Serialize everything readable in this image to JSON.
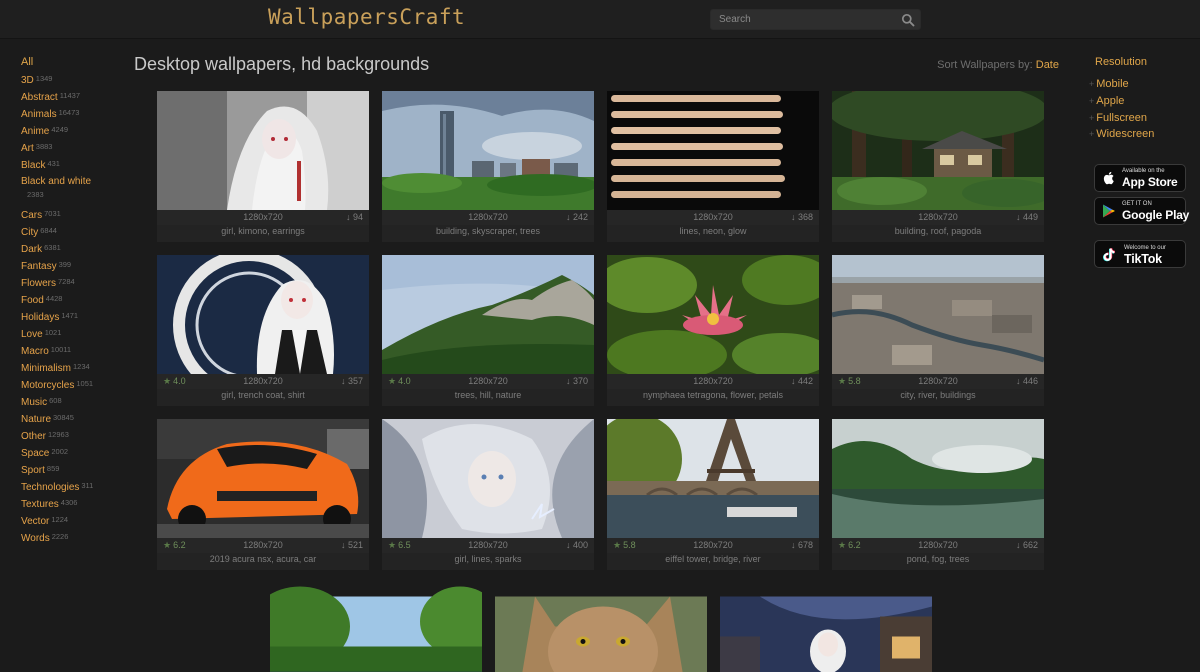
{
  "header": {
    "logo": "WallpapersCraft",
    "search_placeholder": "Search"
  },
  "categories": {
    "all_label": "All",
    "items": [
      {
        "name": "3D",
        "count": "1349"
      },
      {
        "name": "Abstract",
        "count": "11437"
      },
      {
        "name": "Animals",
        "count": "16473"
      },
      {
        "name": "Anime",
        "count": "4249"
      },
      {
        "name": "Art",
        "count": "3883"
      },
      {
        "name": "Black",
        "count": "431"
      },
      {
        "name": "Black and white",
        "count": "2383"
      },
      {
        "name": "Cars",
        "count": "7031"
      },
      {
        "name": "City",
        "count": "6844"
      },
      {
        "name": "Dark",
        "count": "6381"
      },
      {
        "name": "Fantasy",
        "count": "399"
      },
      {
        "name": "Flowers",
        "count": "7284"
      },
      {
        "name": "Food",
        "count": "4428"
      },
      {
        "name": "Holidays",
        "count": "1471"
      },
      {
        "name": "Love",
        "count": "1021"
      },
      {
        "name": "Macro",
        "count": "10011"
      },
      {
        "name": "Minimalism",
        "count": "1234"
      },
      {
        "name": "Motorcycles",
        "count": "1051"
      },
      {
        "name": "Music",
        "count": "608"
      },
      {
        "name": "Nature",
        "count": "30845"
      },
      {
        "name": "Other",
        "count": "12963"
      },
      {
        "name": "Space",
        "count": "2002"
      },
      {
        "name": "Sport",
        "count": "859"
      },
      {
        "name": "Technologies",
        "count": "311"
      },
      {
        "name": "Textures",
        "count": "4306"
      },
      {
        "name": "Vector",
        "count": "1224"
      },
      {
        "name": "Words",
        "count": "2226"
      }
    ]
  },
  "main": {
    "title": "Desktop wallpapers, hd backgrounds",
    "sort_label": "Sort Wallpapers by:",
    "sort_value": "Date"
  },
  "resolution": {
    "title": "Resolution",
    "items": [
      "Mobile",
      "Apple",
      "Fullscreen",
      "Widescreen"
    ]
  },
  "stores": {
    "appstore": {
      "small": "Available on the",
      "big": "App Store"
    },
    "googleplay": {
      "small": "GET IT ON",
      "big": "Google Play"
    },
    "tiktok": {
      "small": "Welcome to our",
      "big": "TikTok"
    }
  },
  "wallpapers": [
    {
      "rating": "",
      "resolution": "1280x720",
      "downloads": "↓ 94",
      "tags": "girl, kimono, earrings"
    },
    {
      "rating": "",
      "resolution": "1280x720",
      "downloads": "↓ 242",
      "tags": "building, skyscraper, trees"
    },
    {
      "rating": "",
      "resolution": "1280x720",
      "downloads": "↓ 368",
      "tags": "lines, neon, glow"
    },
    {
      "rating": "",
      "resolution": "1280x720",
      "downloads": "↓ 449",
      "tags": "building, roof, pagoda"
    },
    {
      "rating": "4.0",
      "resolution": "1280x720",
      "downloads": "↓ 357",
      "tags": "girl, trench coat, shirt"
    },
    {
      "rating": "4.0",
      "resolution": "1280x720",
      "downloads": "↓ 370",
      "tags": "trees, hill, nature"
    },
    {
      "rating": "",
      "resolution": "1280x720",
      "downloads": "↓ 442",
      "tags": "nymphaea tetragona, flower, petals"
    },
    {
      "rating": "5.8",
      "resolution": "1280x720",
      "downloads": "↓ 446",
      "tags": "city, river, buildings"
    },
    {
      "rating": "6.2",
      "resolution": "1280x720",
      "downloads": "↓ 521",
      "tags": "2019 acura nsx, acura, car"
    },
    {
      "rating": "6.5",
      "resolution": "1280x720",
      "downloads": "↓ 400",
      "tags": "girl, lines, sparks"
    },
    {
      "rating": "5.8",
      "resolution": "1280x720",
      "downloads": "↓ 678",
      "tags": "eiffel tower, bridge, river"
    },
    {
      "rating": "6.2",
      "resolution": "1280x720",
      "downloads": "↓ 662",
      "tags": "pond, fog, trees"
    }
  ],
  "colors": {
    "accent": "#e0a64a",
    "background": "#1b1b1b",
    "card": "#232323",
    "rating_green": "#6f8f5b"
  }
}
